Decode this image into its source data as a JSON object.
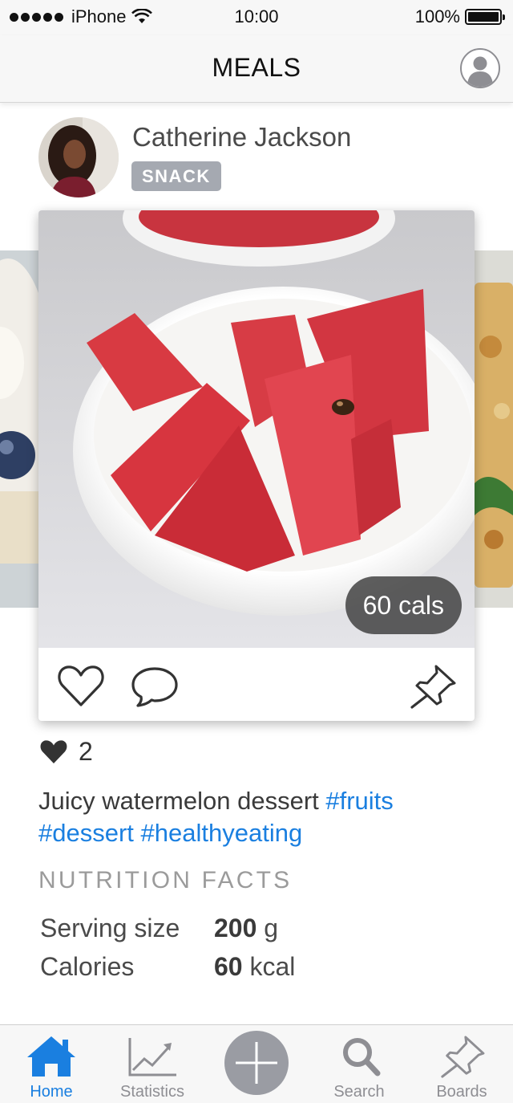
{
  "status_bar": {
    "carrier": "iPhone",
    "time": "10:00",
    "battery": "100%"
  },
  "nav": {
    "title": "MEALS",
    "profile_icon": "user-circle-icon"
  },
  "post": {
    "author_name": "Catherine Jackson",
    "meal_type": "SNACK",
    "calories_badge": "60 cals",
    "likes_count": "2",
    "description_text": "Juicy watermelon dessert",
    "hashtags": [
      "#fruits",
      "#dessert",
      "#healthyeating"
    ],
    "actions": {
      "like_icon": "heart-outline-icon",
      "comment_icon": "speech-bubble-icon",
      "pin_icon": "pushpin-icon"
    }
  },
  "nutrition": {
    "title": "NUTRITION FACTS",
    "rows": [
      {
        "label": "Serving size",
        "value": "200",
        "unit": "g"
      },
      {
        "label": "Calories",
        "value": "60",
        "unit": "kcal"
      }
    ]
  },
  "tabs": [
    {
      "label": "Home",
      "icon": "house-icon",
      "active": true
    },
    {
      "label": "Statistics",
      "icon": "chart-icon",
      "active": false
    },
    {
      "label": "",
      "icon": "plus-icon",
      "active": false
    },
    {
      "label": "Search",
      "icon": "magnifier-icon",
      "active": false
    },
    {
      "label": "Boards",
      "icon": "pushpin-icon",
      "active": false
    }
  ],
  "colors": {
    "accent": "#1a7fe0",
    "tag_bg": "#a5a9b1",
    "inactive": "#8e8e93"
  }
}
